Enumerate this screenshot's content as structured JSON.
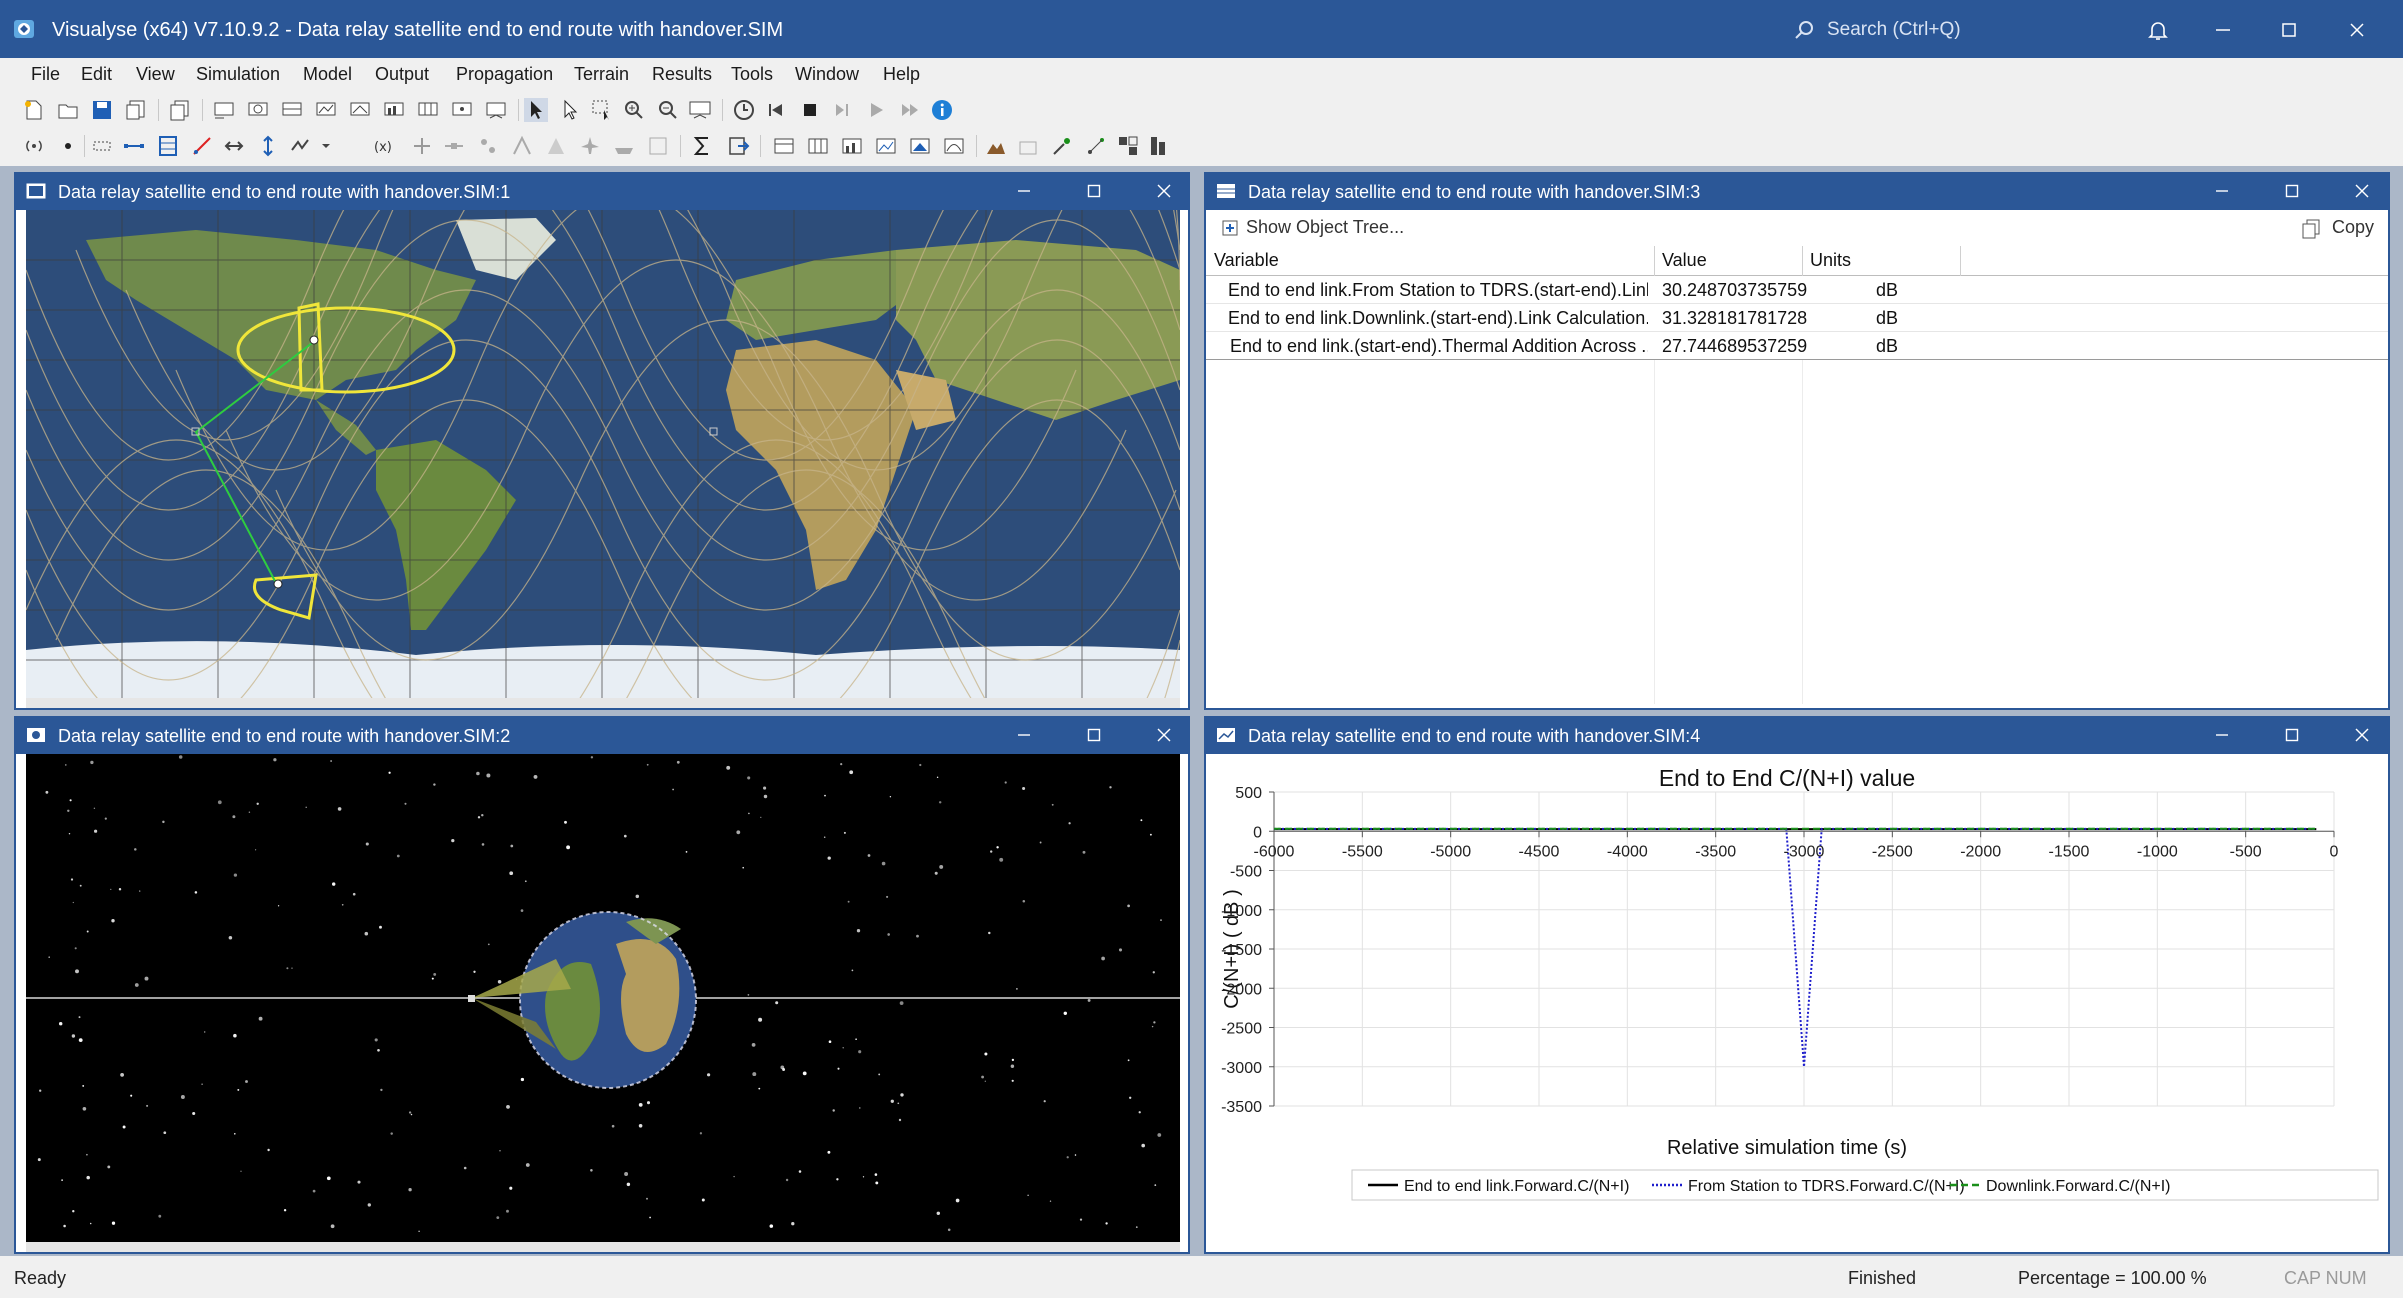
{
  "app": {
    "title": "Visualyse (x64) V7.10.9.2 - Data relay satellite end to end route with handover.SIM",
    "search_placeholder": "Search (Ctrl+Q)",
    "accent_color": "#2b5797"
  },
  "menu": [
    "File",
    "Edit",
    "View",
    "Simulation",
    "Model",
    "Output",
    "Propagation",
    "Terrain",
    "Results",
    "Tools",
    "Window",
    "Help"
  ],
  "windows": {
    "map": {
      "title": "Data relay satellite end to end route with handover.SIM:1"
    },
    "globe": {
      "title": "Data relay satellite end to end route with handover.SIM:2"
    },
    "table": {
      "title": "Data relay satellite end to end route with handover.SIM:3",
      "show_tree_label": "Show Object Tree...",
      "copy_label": "Copy",
      "columns": [
        "Variable",
        "Value",
        "Units"
      ],
      "rows": [
        {
          "variable": "End to end link.From Station to TDRS.(start-end).Link...",
          "value": "30.248703735759",
          "units": "dB"
        },
        {
          "variable": "End to end link.Downlink.(start-end).Link Calculation....",
          "value": "31.328181781728",
          "units": "dB"
        },
        {
          "variable": "End to end link.(start-end).Thermal Addition Across ...",
          "value": "27.744689537259",
          "units": "dB"
        }
      ]
    },
    "chart": {
      "title": "Data relay satellite end to end route with handover.SIM:4"
    }
  },
  "chart_data": {
    "type": "line",
    "title": "End to End C/(N+I)  value",
    "xlabel": "Relative simulation time (s)",
    "ylabel": "C/(N+I) ( dB )",
    "xlim": [
      -6000,
      0
    ],
    "ylim": [
      -3500,
      500
    ],
    "xticks": [
      -6000,
      -5500,
      -5000,
      -4500,
      -4000,
      -3500,
      -3000,
      -2500,
      -2000,
      -1500,
      -1000,
      -500,
      0
    ],
    "yticks": [
      500,
      0,
      -500,
      -1000,
      -1500,
      -2000,
      -2500,
      -3000,
      -3500
    ],
    "grid": true,
    "legend_position": "bottom",
    "series": [
      {
        "name": "End to end link.Forward.C/(N+I)",
        "color": "#000000",
        "style": "solid",
        "x": [
          -6000,
          -3100,
          -3050,
          -3000,
          -2950,
          -2900,
          -100
        ],
        "y": [
          28,
          28,
          28,
          28,
          28,
          28,
          28
        ]
      },
      {
        "name": "From Station to TDRS.Forward.C/(N+I)",
        "color": "#1f1fcc",
        "style": "dotted",
        "x": [
          -6000,
          -3100,
          -3000,
          -2900,
          -100
        ],
        "y": [
          30,
          30,
          -3000,
          30,
          30
        ]
      },
      {
        "name": "Downlink.Forward.C/(N+I)",
        "color": "#1a8f1a",
        "style": "dashed",
        "x": [
          -6000,
          -3100,
          -3000,
          -2900,
          -100
        ],
        "y": [
          31,
          31,
          31,
          31,
          31
        ]
      }
    ]
  },
  "status": {
    "left": "Ready",
    "state": "Finished",
    "percentage": "Percentage = 100.00 %",
    "keys": "CAP  NUM"
  }
}
